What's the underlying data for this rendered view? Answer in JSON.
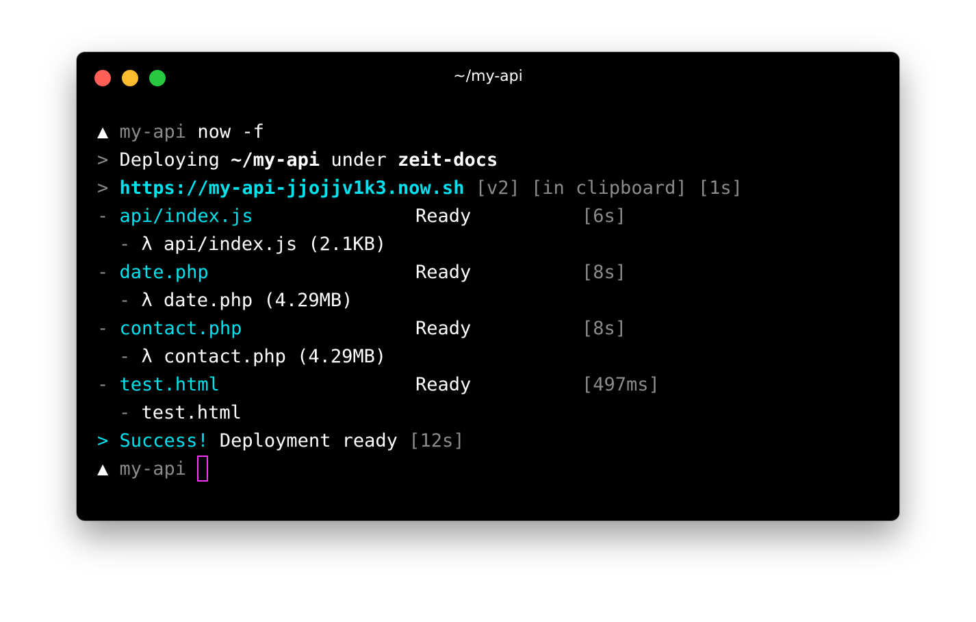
{
  "window": {
    "title": "~/my-api"
  },
  "terminal": {
    "prompt_symbol": "▲",
    "command_prompt": {
      "dir": "my-api",
      "command": "now -f"
    },
    "deploying": {
      "marker": ">",
      "word": "Deploying",
      "path": "~/my-api",
      "under": "under",
      "team": "zeit-docs"
    },
    "url_line": {
      "marker": ">",
      "url": "https://my-api-jjojjv1k3.now.sh",
      "version": "[v2]",
      "clipboard": "[in clipboard]",
      "time": "[1s]"
    },
    "builds": [
      {
        "dash": "-",
        "file": "api/index.js",
        "status": "Ready",
        "time": "[6s]",
        "sub_dash": "-",
        "sub": "λ api/index.js (2.1KB)"
      },
      {
        "dash": "-",
        "file": "date.php",
        "status": "Ready",
        "time": "[8s]",
        "sub_dash": "-",
        "sub": "λ date.php (4.29MB)"
      },
      {
        "dash": "-",
        "file": "contact.php",
        "status": "Ready",
        "time": "[8s]",
        "sub_dash": "-",
        "sub": "λ contact.php (4.29MB)"
      },
      {
        "dash": "-",
        "file": "test.html",
        "status": "Ready",
        "time": "[497ms]",
        "sub_dash": "-",
        "sub": "test.html"
      }
    ],
    "success": {
      "marker": ">",
      "word": "Success!",
      "message": "Deployment ready",
      "time": "[12s]"
    },
    "final_prompt": {
      "dir": "my-api"
    }
  },
  "colors": {
    "accent_cyan": "#00e1ee",
    "muted_gray": "#8b8b8b",
    "cursor_magenta": "#ff33ff",
    "traffic_red": "#fe5f57",
    "traffic_yellow": "#febc2e",
    "traffic_green": "#28c840"
  }
}
